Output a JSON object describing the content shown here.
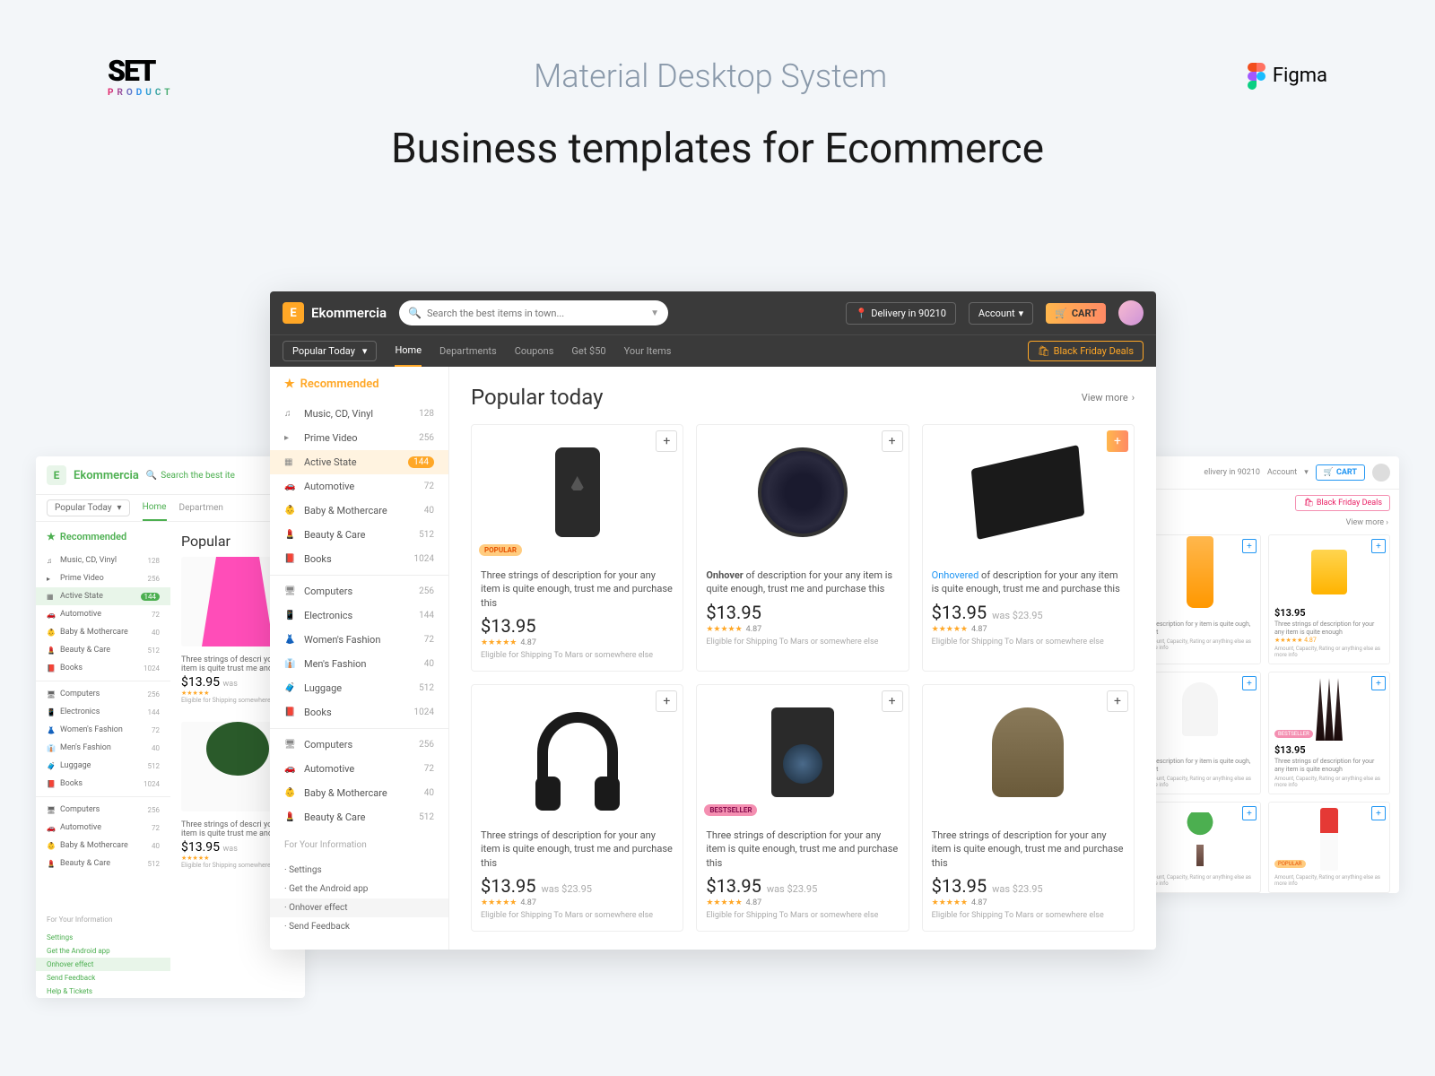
{
  "header": {
    "subtitle": "Material Desktop System",
    "title": "Business templates for Ecommerce",
    "setproduct": "PRODUCT",
    "figma": "Figma"
  },
  "dark": {
    "brand": "Ekommercia",
    "brandLetter": "E",
    "search": {
      "placeholder": "Search the best items in town..."
    },
    "delivery": "Delivery in 90210",
    "account": "Account",
    "cart": "CART",
    "dropdown": "Popular Today",
    "nav": [
      "Home",
      "Departments",
      "Coupons",
      "Get $50",
      "Your Items"
    ],
    "bfdeals": "Black Friday Deals",
    "sidebar": {
      "head": "Recommended",
      "items": [
        {
          "label": "Music, CD, Vinyl",
          "count": "128"
        },
        {
          "label": "Prime Video",
          "count": "256"
        },
        {
          "label": "Active State",
          "count": "144",
          "active": true
        },
        {
          "label": "Automotive",
          "count": "72"
        },
        {
          "label": "Baby & Mothercare",
          "count": "40"
        },
        {
          "label": "Beauty & Care",
          "count": "512"
        },
        {
          "label": "Books",
          "count": "1024"
        },
        {
          "label": "Computers",
          "count": "256"
        },
        {
          "label": "Electronics",
          "count": "144"
        },
        {
          "label": "Women's Fashion",
          "count": "72"
        },
        {
          "label": "Men's Fashion",
          "count": "40"
        },
        {
          "label": "Luggage",
          "count": "512"
        },
        {
          "label": "Books",
          "count": "1024"
        },
        {
          "label": "Computers",
          "count": "256"
        },
        {
          "label": "Automotive",
          "count": "72"
        },
        {
          "label": "Baby & Mothercare",
          "count": "40"
        },
        {
          "label": "Beauty & Care",
          "count": "512"
        }
      ],
      "footer": "For Your Information",
      "links": [
        "Settings",
        "Get the Android app",
        "Onhover effect",
        "Send Feedback"
      ]
    },
    "content": {
      "title": "Popular today",
      "viewmore": "View more",
      "desc": "Three strings of description for your any item is quite enough, trust me and purchase this",
      "price": "$13.95",
      "was": "was $23.95",
      "rating": "★★★★★",
      "rcount": "4.87",
      "ship": "Eligible for Shipping To Mars or somewhere else",
      "onhover": "Onhover",
      "onhovered": "Onhovered",
      "badges": {
        "popular": "POPULAR",
        "bestseller": "BESTSELLER"
      }
    }
  },
  "green": {
    "brand": "Ekommercia",
    "brandLetter": "E",
    "search": "Search the best ite",
    "dropdown": "Popular Today",
    "nav": [
      "Home",
      "Departmen"
    ],
    "sidebar": {
      "head": "Recommended",
      "items": [
        {
          "label": "Music, CD, Vinyl",
          "count": "128"
        },
        {
          "label": "Prime Video",
          "count": "256"
        },
        {
          "label": "Active State",
          "count": "144",
          "active": true
        },
        {
          "label": "Automotive",
          "count": "72"
        },
        {
          "label": "Baby & Mothercare",
          "count": "40"
        },
        {
          "label": "Beauty & Care",
          "count": "512"
        },
        {
          "label": "Books",
          "count": "1024"
        },
        {
          "label": "Computers",
          "count": "256"
        },
        {
          "label": "Electronics",
          "count": "144"
        },
        {
          "label": "Women's Fashion",
          "count": "72"
        },
        {
          "label": "Men's Fashion",
          "count": "40"
        },
        {
          "label": "Luggage",
          "count": "512"
        },
        {
          "label": "Books",
          "count": "1024"
        },
        {
          "label": "Computers",
          "count": "256"
        },
        {
          "label": "Automotive",
          "count": "72"
        },
        {
          "label": "Baby & Mothercare",
          "count": "40"
        },
        {
          "label": "Beauty & Care",
          "count": "512"
        }
      ],
      "footer": "For Your Information",
      "links": [
        "Settings",
        "Get the Android app",
        "Onhover effect",
        "Send Feedback",
        "Help & Tickets"
      ]
    },
    "title": "Popular",
    "desc": "Three strings of descri your any item is quite trust me and pu",
    "price": "$13.95",
    "was": "was",
    "ship": "Eligible for Shipping somewhere else"
  },
  "blue": {
    "delivery": "elivery in 90210",
    "account": "Account",
    "cart": "CART",
    "bfdeals": "Black Friday Deals",
    "viewmore": "View more",
    "price": "$13.95",
    "p2": "5",
    "desc": "Three strings of description for your any item is quite enough",
    "desc2": "of description for y item is quite ough, trust",
    "sub": "Amount, Capacity, Rating or anything else as more info",
    "rating": "★★★★★ 4.87",
    "badges": {
      "bestseller": "BESTSELLER",
      "popular": "POPULAR"
    }
  }
}
